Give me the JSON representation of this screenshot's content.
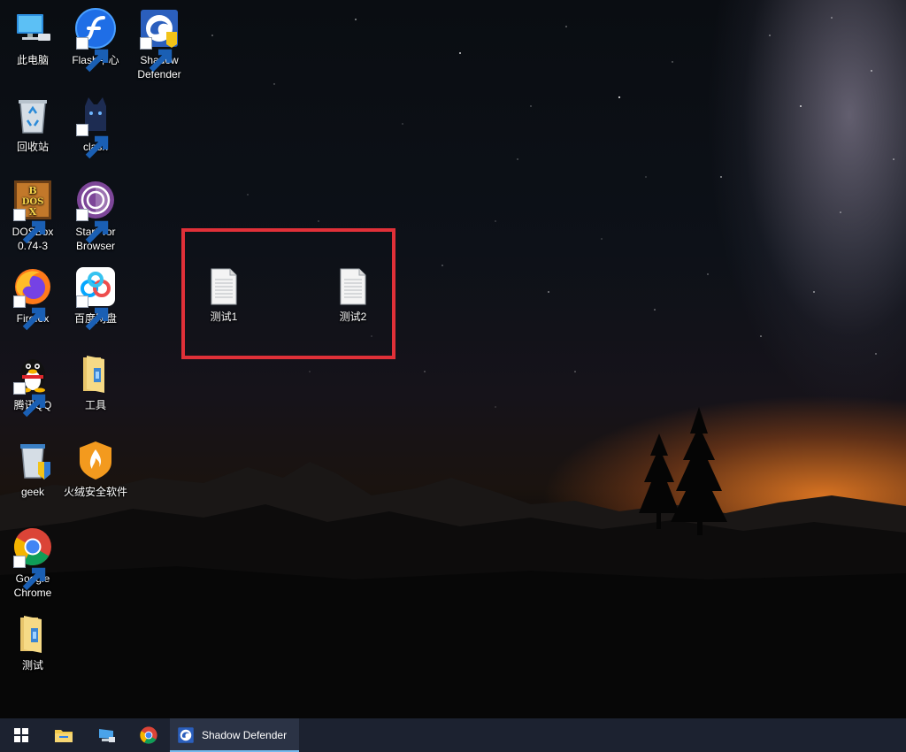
{
  "desktop_icons": {
    "this_pc": "此电脑",
    "flash": "Flash中心",
    "shadow_defender": "Shadow Defender",
    "recycle_bin": "回收站",
    "clash": "clash",
    "dosbox": "DOSBox 0.74-3",
    "tor": "Start Tor Browser",
    "firefox": "Firefox",
    "baidu_pan": "百度网盘",
    "qq": "腾讯QQ",
    "tools": "工具",
    "geek": "geek",
    "huorong": "火绒安全软件",
    "chrome": "Google Chrome",
    "test_folder": "测试"
  },
  "highlighted_files": {
    "file1": "测试1",
    "file2": "测试2"
  },
  "taskbar": {
    "active_app": "Shadow Defender"
  },
  "colors": {
    "highlight_border": "#e03038",
    "taskbar_bg": "#1c2230"
  }
}
